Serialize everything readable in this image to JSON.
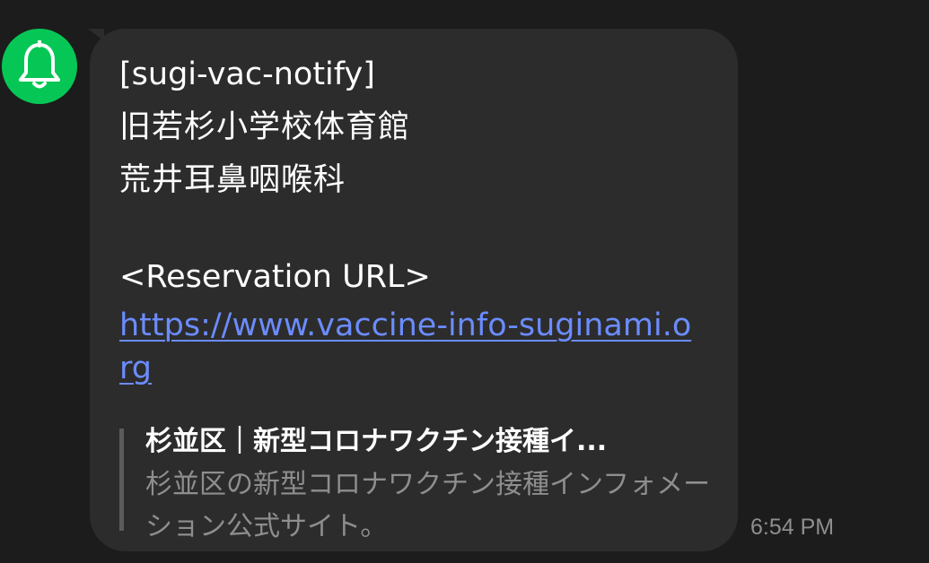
{
  "sender": {
    "avatar_icon": "bell-icon",
    "avatar_color": "#06c755"
  },
  "message": {
    "lines": [
      "[sugi-vac-notify]",
      "旧若杉小学校体育館",
      "荒井耳鼻咽喉科"
    ],
    "reservation_label": "<Reservation URL>",
    "link_url": "https://www.vaccine-info-suginami.org",
    "link_color": "#6b8cff"
  },
  "link_preview": {
    "title": "杉並区｜新型コロナワクチン接種イ...",
    "description": "杉並区の新型コロナワクチン接種インフォメーション公式サイト。"
  },
  "timestamp": "6:54 PM"
}
